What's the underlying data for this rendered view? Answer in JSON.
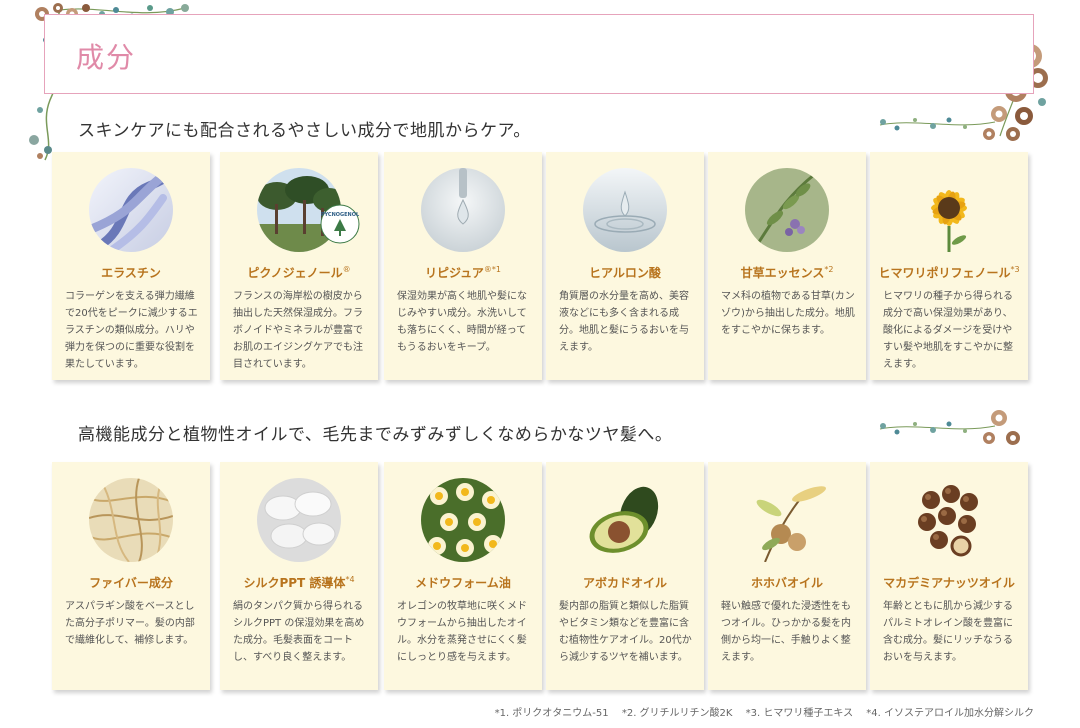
{
  "page": {
    "title": "成分"
  },
  "sections": [
    {
      "heading": "スキンケアにも配合されるやさしい成分で地肌からケア。",
      "cards": [
        {
          "name": "エラスチン",
          "sup": "",
          "desc": "コラーゲンを支える弾力繊維で20代をピークに減少するエラスチンの類似成分。ハリや弾力を保つのに重要な役割を果たしています。"
        },
        {
          "name": "ピクノジェノール",
          "sup": "®",
          "desc": "フランスの海岸松の樹皮から抽出した天然保湿成分。フラボノイドやミネラルが豊富でお肌のエイジングケアでも注目されています。"
        },
        {
          "name": "リピジュア",
          "sup": "®*1",
          "desc": "保湿効果が高く地肌や髪になじみやすい成分。水洗いしても落ちにくく、時間が経ってもうるおいをキープ。"
        },
        {
          "name": "ヒアルロン酸",
          "sup": "",
          "desc": "角質層の水分量を高め、美容液などにも多く含まれる成分。地肌と髪にうるおいを与えます。"
        },
        {
          "name": "甘草エッセンス",
          "sup": "*2",
          "desc": "マメ科の植物である甘草(カンゾウ)から抽出した成分。地肌をすこやかに保ちます。"
        },
        {
          "name": "ヒマワリポリフェノール",
          "sup": "*3",
          "desc": "ヒマワリの種子から得られる成分で高い保湿効果があり、酸化によるダメージを受けやすい髪や地肌をすこやかに整えます。"
        }
      ]
    },
    {
      "heading": "高機能成分と植物性オイルで、毛先までみずみずしくなめらかなツヤ髪へ。",
      "cards": [
        {
          "name": "ファイバー成分",
          "sup": "",
          "desc": "アスパラギン酸をベースとした高分子ポリマー。髪の内部で繊維化して、補修します。"
        },
        {
          "name": "シルクPPT 誘導体",
          "sup": "*4",
          "desc": "絹のタンパク質から得られるシルクPPT の保湿効果を高めた成分。毛髪表面をコートし、すべり良く整えます。"
        },
        {
          "name": "メドウフォーム油",
          "sup": "",
          "desc": "オレゴンの牧草地に咲くメドウフォームから抽出したオイル。水分を蒸発させにくく髪にしっとり感を与えます。"
        },
        {
          "name": "アボカドオイル",
          "sup": "",
          "desc": "髪内部の脂質と類似した脂質やビタミン類などを豊富に含む植物性ケアオイル。20代から減少するツヤを補います。"
        },
        {
          "name": "ホホバオイル",
          "sup": "",
          "desc": "軽い触感で優れた浸透性をもつオイル。ひっかかる髪を内側から均一に、手触りよく整えます。"
        },
        {
          "name": "マカデミアナッツオイル",
          "sup": "",
          "desc": "年齢とともに肌から減少するパルミトオレイン酸を豊富に含む成分。髪にリッチなうるおいを与えます。"
        }
      ]
    }
  ],
  "footnotes": [
    "*1. ポリクオタニウム-51",
    "*2. グリチルリチン酸2K",
    "*3. ヒマワリ種子エキス",
    "*4. イソステアロイル加水分解シルク"
  ],
  "logo_text": "PYCNOGENOL",
  "colors": {
    "frame": "#e6a3bb",
    "title": "#e08aa8",
    "ingredient_name": "#b8741e",
    "card_bg": "#fdf8df"
  }
}
